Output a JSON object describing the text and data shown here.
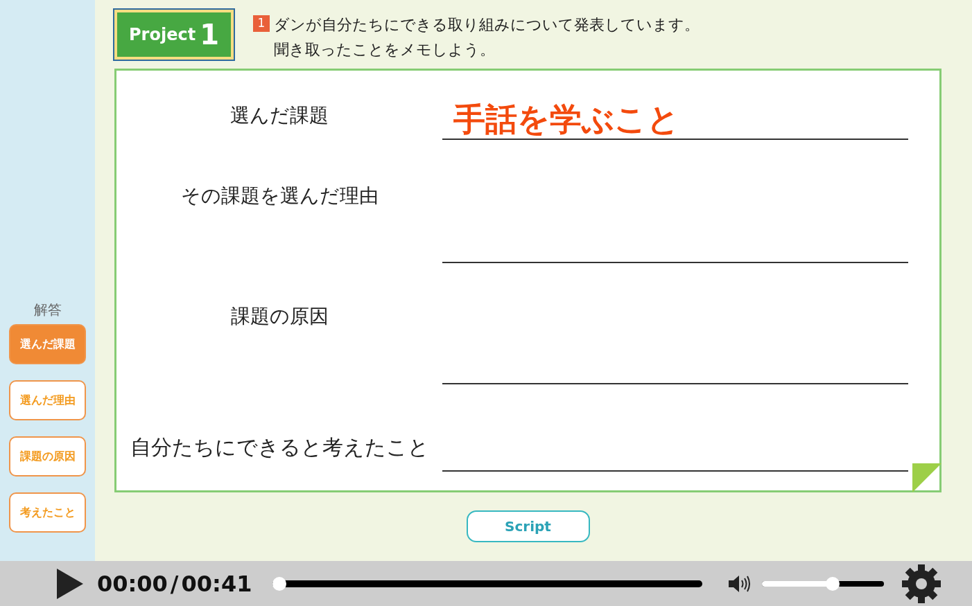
{
  "sidebar": {
    "title": "解答",
    "buttons": [
      {
        "label": "選んだ課題",
        "selected": true
      },
      {
        "label": "選んだ理由",
        "selected": false
      },
      {
        "label": "課題の原因",
        "selected": false
      },
      {
        "label": "考えたこと",
        "selected": false
      }
    ]
  },
  "header": {
    "badge_word": "Project",
    "badge_number": "1",
    "task_number": "1",
    "instruction_lines": [
      "ダンが自分たちにできる取り組みについて発表しています。",
      "聞き取ったことをメモしよう。"
    ]
  },
  "memo": {
    "rows": [
      {
        "label": "選んだ課題",
        "answer": "手話を学ぶこと"
      },
      {
        "label": "その課題を選んだ理由"
      },
      {
        "label": "課題の原因"
      },
      {
        "label": "自分たちにできると考えたこと"
      }
    ]
  },
  "script_button": "Script",
  "player": {
    "current_time": "00:00",
    "separator": "/",
    "duration": "00:41",
    "progress": {
      "level": 0
    },
    "volume": {
      "level": 0.58
    }
  }
}
